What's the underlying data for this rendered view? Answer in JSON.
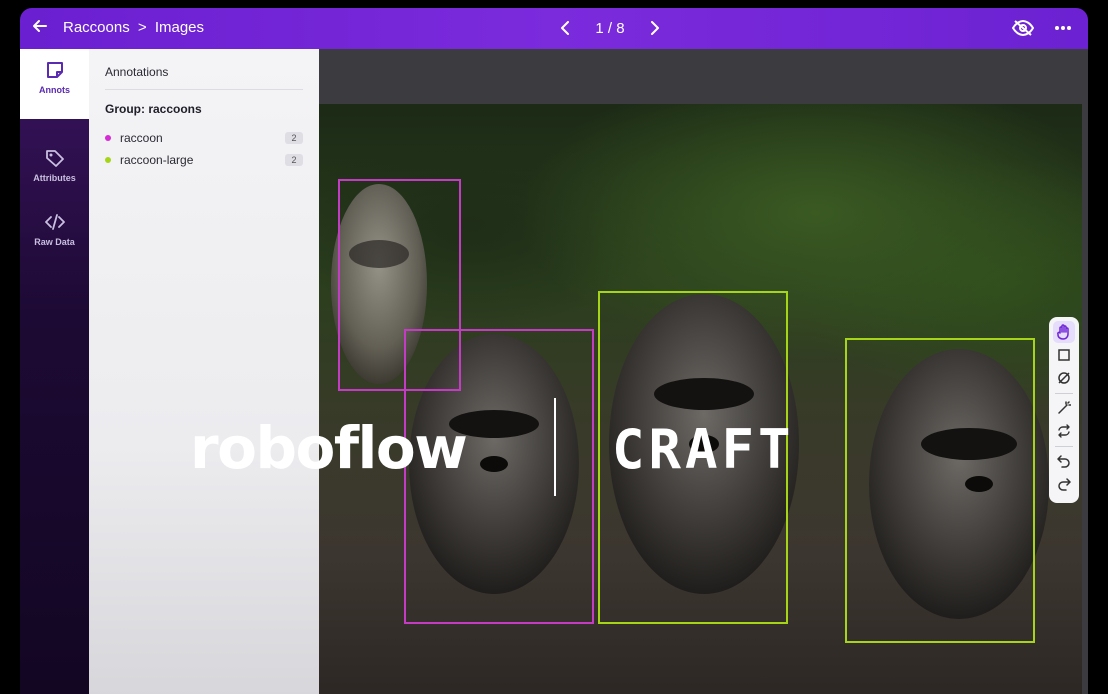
{
  "header": {
    "breadcrumb_project": "Raccoons",
    "breadcrumb_sep": ">",
    "breadcrumb_section": "Images",
    "pager_text": "1 / 8"
  },
  "rail": {
    "items": [
      {
        "label": "Annots",
        "icon": "sticky-note-icon",
        "active": true
      },
      {
        "label": "Attributes",
        "icon": "tag-icon",
        "active": false
      },
      {
        "label": "Raw Data",
        "icon": "code-icon",
        "active": false
      }
    ]
  },
  "panel": {
    "title": "Annotations",
    "group_title": "Group: raccoons",
    "classes": [
      {
        "name": "raccoon",
        "count": "2",
        "color": "#d62ad6"
      },
      {
        "name": "raccoon-large",
        "count": "2",
        "color": "#a6d417"
      }
    ]
  },
  "tools": [
    "hand-icon",
    "bounding-box-icon",
    "polygon-icon",
    "magic-wand-icon",
    "repeat-icon",
    "undo-icon",
    "redo-icon"
  ],
  "colors": {
    "accent": "#6f24d6",
    "bbox_raccoon": "#c43cc4",
    "bbox_raccoon_large": "#a6d417"
  },
  "branding": {
    "left": "roboflow",
    "right": "CRAFT"
  }
}
